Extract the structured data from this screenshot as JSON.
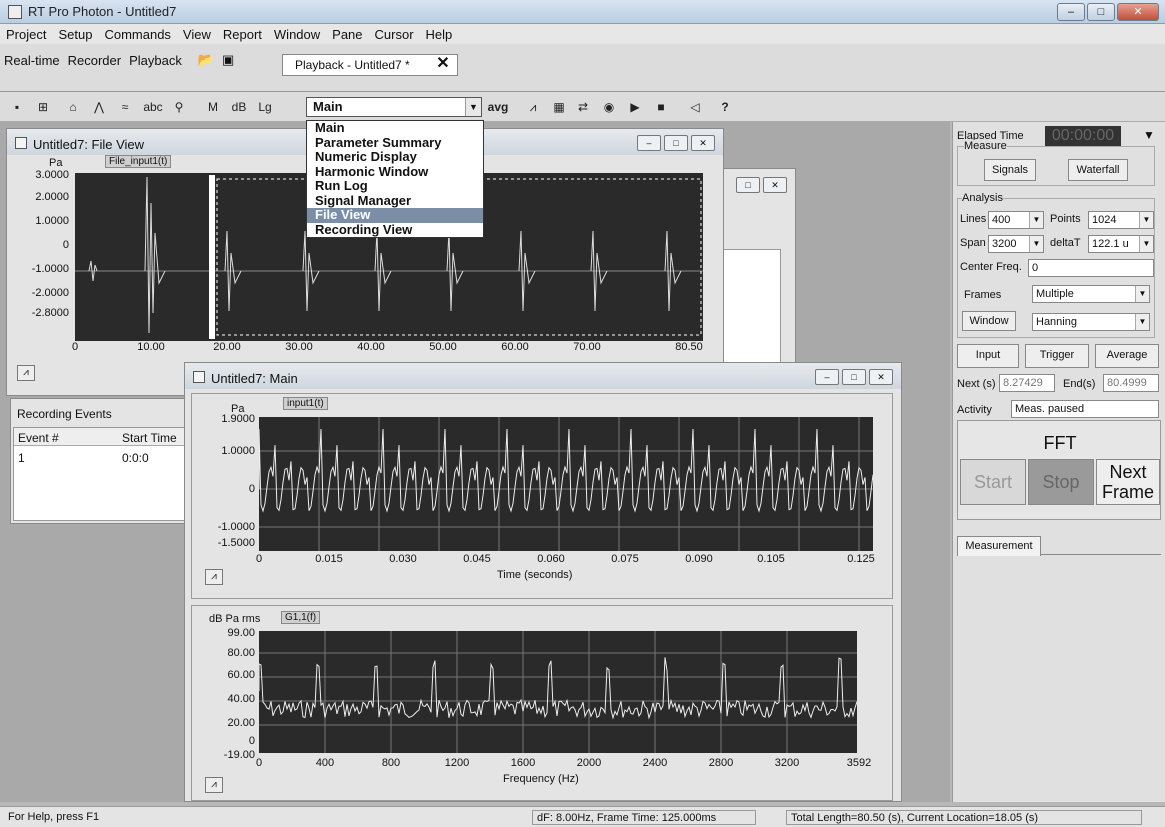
{
  "app": {
    "title": "RT Pro Photon - Untitled7"
  },
  "menu": [
    "Project",
    "Setup",
    "Commands",
    "View",
    "Report",
    "Window",
    "Pane",
    "Cursor",
    "Help"
  ],
  "modes": [
    "Real-time",
    "Recorder",
    "Playback"
  ],
  "playback_tab": "Playback - Untitled7 *",
  "toolbar": {
    "view_select": "Main",
    "avg_label": "avg",
    "abc_label": "abc",
    "help_label": "?"
  },
  "view_dropdown": {
    "options": [
      "Main",
      "Parameter Summary",
      "Numeric Display",
      "Harmonic Window",
      "Run Log",
      "Signal Manager",
      "File View",
      "Recording View"
    ],
    "highlighted": "File View"
  },
  "file_view": {
    "title": "Untitled7: File View",
    "unit": "Pa",
    "signal": "File_input1(t)",
    "yticks": [
      "3.0000",
      "2.0000",
      "1.0000",
      "0",
      "-1.0000",
      "-2.0000",
      "-2.8000"
    ],
    "xticks": [
      "0",
      "10.00",
      "20.00",
      "30.00",
      "40.00",
      "50.00",
      "60.00",
      "70.00",
      "80.50"
    ]
  },
  "recording_events": {
    "title": "Recording Events",
    "columns": [
      "Event #",
      "Start Time"
    ],
    "rows": [
      [
        "1",
        "0:0:0"
      ]
    ]
  },
  "main_view": {
    "title": "Untitled7: Main",
    "time_plot": {
      "unit": "Pa",
      "signal": "input1(t)",
      "yticks": [
        "1.9000",
        "1.0000",
        "0",
        "-1.0000",
        "-1.5000"
      ],
      "xticks": [
        "0",
        "0.015",
        "0.030",
        "0.045",
        "0.060",
        "0.075",
        "0.090",
        "0.105",
        "0.125"
      ],
      "xlabel": "Time (seconds)"
    },
    "freq_plot": {
      "unit": "dB Pa rms",
      "signal": "G1,1(f)",
      "yticks": [
        "99.00",
        "80.00",
        "60.00",
        "40.00",
        "20.00",
        "0",
        "-19.00"
      ],
      "xticks": [
        "0",
        "400",
        "800",
        "1200",
        "1600",
        "2000",
        "2400",
        "2800",
        "3200",
        "3592"
      ],
      "xlabel": "Frequency (Hz)"
    }
  },
  "right_panel": {
    "elapsed_label": "Elapsed Time",
    "elapsed_value": "00:00:00",
    "measure_group": "Measure",
    "signals_btn": "Signals",
    "waterfall_btn": "Waterfall",
    "analysis_group": "Analysis",
    "lines_label": "Lines",
    "lines_value": "400",
    "points_label": "Points",
    "points_value": "1024",
    "span_label": "Span",
    "span_value": "3200",
    "deltat_label": "deltaT",
    "deltat_value": "122.1 u",
    "center_label": "Center Freq.",
    "center_value": "0",
    "frames_label": "Frames",
    "frames_value": "Multiple",
    "window_btn": "Window",
    "window_value": "Hanning",
    "input_btn": "Input",
    "trigger_btn": "Trigger",
    "average_btn": "Average",
    "next_label": "Next (s)",
    "next_value": "8.27429",
    "end_label": "End(s)",
    "end_value": "80.4999",
    "activity_label": "Activity",
    "activity_value": "Meas. paused",
    "fft_label": "FFT",
    "start_btn": "Start",
    "stop_btn": "Stop",
    "next_frame_btn": "Next Frame",
    "measurement_tab": "Measurement"
  },
  "status": {
    "help": "For Help, press F1",
    "frame": "dF: 8.00Hz, Frame Time: 125.000ms",
    "location": "Total Length=80.50 (s), Current Location=18.05 (s)"
  }
}
